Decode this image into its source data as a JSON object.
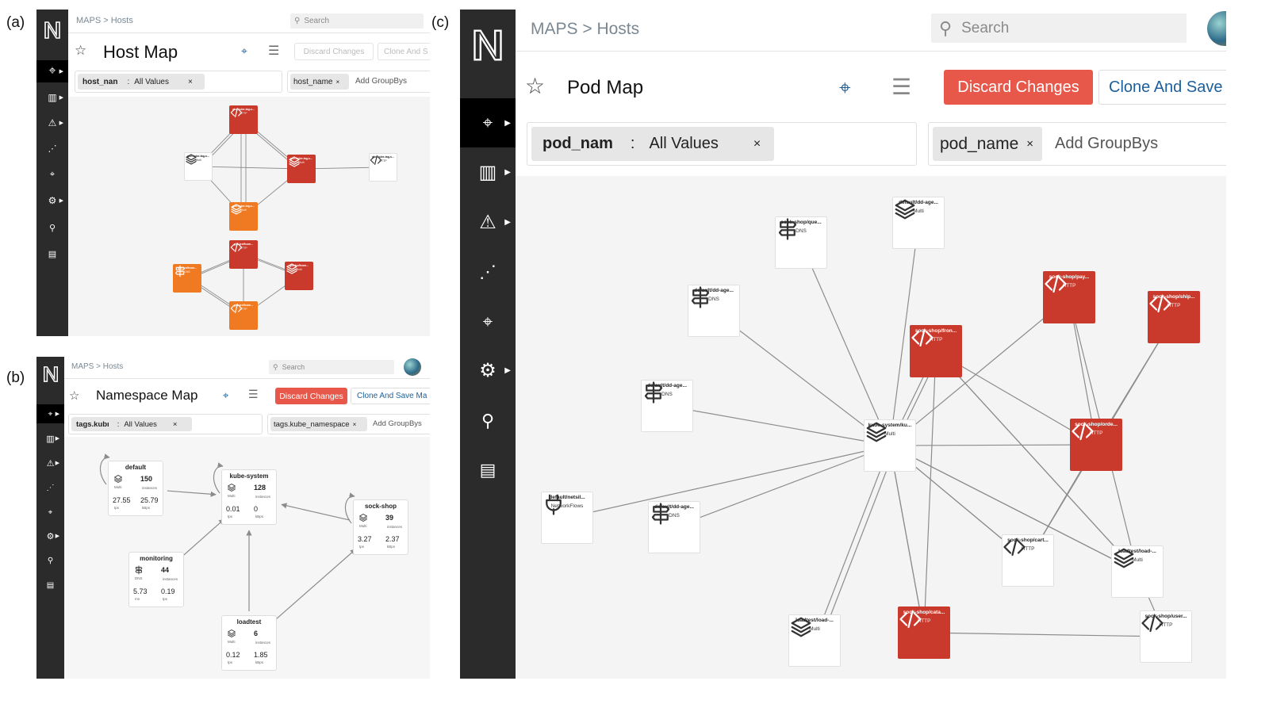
{
  "labels": {
    "a": "(a)",
    "b": "(b)",
    "c": "(c)"
  },
  "common": {
    "breadcrumb": "MAPS > Hosts",
    "search_placeholder": "Search",
    "discard": "Discard Changes",
    "add_groupbys": "Add GroupBys",
    "remove": "×",
    "multi": "Multi",
    "http": "HTTP",
    "dns": "DNS",
    "networkflows": "NetworkFlows",
    "instances": "instances",
    "tps": "tps",
    "kbps": "kBps",
    "ms": "ms"
  },
  "colors": {
    "sidebar": "#2b2b2b",
    "accent_red": "#c93a2c",
    "discard_btn": "#e8584a",
    "orange": "#f07a22",
    "link_blue": "#1d5f9a"
  },
  "panel_a": {
    "title": "Host Map",
    "clone": "Clone And S",
    "filter_key": "host_nan",
    "filter_sep": ":",
    "filter_value": "All Values",
    "groupby": "host_name",
    "nodes": [
      {
        "label": "gke-kube-tag-s...",
        "type": "HTTP",
        "style": "red",
        "icon": "code"
      },
      {
        "label": "gke-kube-tag-s...",
        "type": "Multi",
        "style": "white",
        "icon": "layers"
      },
      {
        "label": "gke-kube-tag-s...",
        "type": "Multi",
        "style": "red",
        "icon": "layers"
      },
      {
        "label": "gke-kube-tag-s...",
        "type": "HTTP",
        "style": "white",
        "icon": "code"
      },
      {
        "label": "gke-kube-tag-s...",
        "type": "Multi",
        "style": "orange",
        "icon": "layers"
      },
      {
        "label": "gke-traffcom...",
        "type": "HTTP",
        "style": "red",
        "icon": "code"
      },
      {
        "label": "gke-traffcom...",
        "type": "DNS",
        "style": "orange",
        "icon": "sign"
      },
      {
        "label": "gke-traffcom...",
        "type": "Multi",
        "style": "red",
        "icon": "layers"
      },
      {
        "label": "gke-traffcom...",
        "type": "HTTP",
        "style": "orange",
        "icon": "code"
      }
    ]
  },
  "panel_b": {
    "title": "Namespace Map",
    "clone": "Clone And Save Ma",
    "filter_key": "tags.kubı",
    "filter_sep": ":",
    "filter_value": "All Values",
    "groupby": "tags.kube_namespace",
    "namespaces": [
      {
        "name": "default",
        "type": "Multi",
        "count": "150",
        "stat1": "27.55",
        "unit1": "tps",
        "stat2": "25.79",
        "unit2": "kBps"
      },
      {
        "name": "kube-system",
        "type": "Multi",
        "count": "128",
        "stat1": "0.01",
        "unit1": "tps",
        "stat2": "0",
        "unit2": "kBps"
      },
      {
        "name": "sock-shop",
        "type": "Multi",
        "count": "39",
        "stat1": "3.27",
        "unit1": "tps",
        "stat2": "2.37",
        "unit2": "kBps"
      },
      {
        "name": "monitoring",
        "type": "DNS",
        "count": "44",
        "stat1": "5.73",
        "unit1": "ms",
        "stat2": "0.19",
        "unit2": "tps"
      },
      {
        "name": "loadtest",
        "type": "Multi",
        "count": "6",
        "stat1": "0.12",
        "unit1": "tps",
        "stat2": "1.85",
        "unit2": "kBps"
      }
    ]
  },
  "panel_c": {
    "title": "Pod Map",
    "clone": "Clone And Save",
    "filter_key": "pod_nam",
    "filter_sep": ":",
    "filter_value": "All Values",
    "groupby": "pod_name",
    "nodes": [
      {
        "label": "sock-shop/que...",
        "type": "DNS",
        "style": "white",
        "icon": "sign"
      },
      {
        "label": "default/dd-age...",
        "type": "Multi",
        "style": "white",
        "icon": "layers"
      },
      {
        "label": "default/dd-age...",
        "type": "DNS",
        "style": "white",
        "icon": "sign"
      },
      {
        "label": "sock-shop/pay...",
        "type": "HTTP",
        "style": "red",
        "icon": "code"
      },
      {
        "label": "sock-shop/ship...",
        "type": "HTTP",
        "style": "red",
        "icon": "code"
      },
      {
        "label": "sock-shop/fron...",
        "type": "HTTP",
        "style": "red",
        "icon": "code"
      },
      {
        "label": "default/dd-age...",
        "type": "DNS",
        "style": "white",
        "icon": "sign"
      },
      {
        "label": "kube-system/ku...",
        "type": "Multi",
        "style": "white",
        "icon": "layers"
      },
      {
        "label": "sock-shop/orde...",
        "type": "HTTP",
        "style": "red",
        "icon": "code"
      },
      {
        "label": "default/netsil...",
        "type": "NetworkFlows",
        "style": "white",
        "icon": "plug"
      },
      {
        "label": "default/dd-age...",
        "type": "DNS",
        "style": "white",
        "icon": "sign"
      },
      {
        "label": "sock-shop/cart...",
        "type": "HTTP",
        "style": "white",
        "icon": "code"
      },
      {
        "label": "loadtest/load-...",
        "type": "Multi",
        "style": "white",
        "icon": "layers"
      },
      {
        "label": "loadtest/load-...",
        "type": "Multi",
        "style": "white",
        "icon": "layers"
      },
      {
        "label": "sock-shop/cata...",
        "type": "HTTP",
        "style": "red",
        "icon": "code"
      },
      {
        "label": "sock-shop/user...",
        "type": "HTTP",
        "style": "white",
        "icon": "code"
      }
    ]
  }
}
